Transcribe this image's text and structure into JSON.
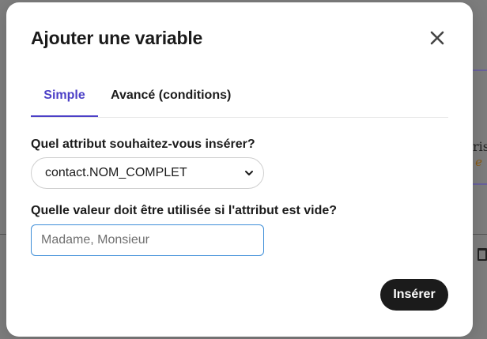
{
  "background": {
    "right_text_1": "ris",
    "right_text_2": "e"
  },
  "modal": {
    "title": "Ajouter une variable",
    "close_icon": "close-icon"
  },
  "tabs": [
    {
      "label": "Simple",
      "active": true
    },
    {
      "label": "Avancé (conditions)",
      "active": false
    }
  ],
  "form": {
    "attribute_label": "Quel attribut souhaitez-vous insérer?",
    "attribute_value": "contact.NOM_COMPLET",
    "default_label": "Quelle valeur doit être utilisée si l'attribut est vide?",
    "default_placeholder": "Madame, Monsieur",
    "default_value": ""
  },
  "footer": {
    "insert_label": "Insérer"
  },
  "colors": {
    "accent": "#4c40c7",
    "primary_button": "#1b1b1b",
    "focus_border": "#3e8ed8"
  }
}
